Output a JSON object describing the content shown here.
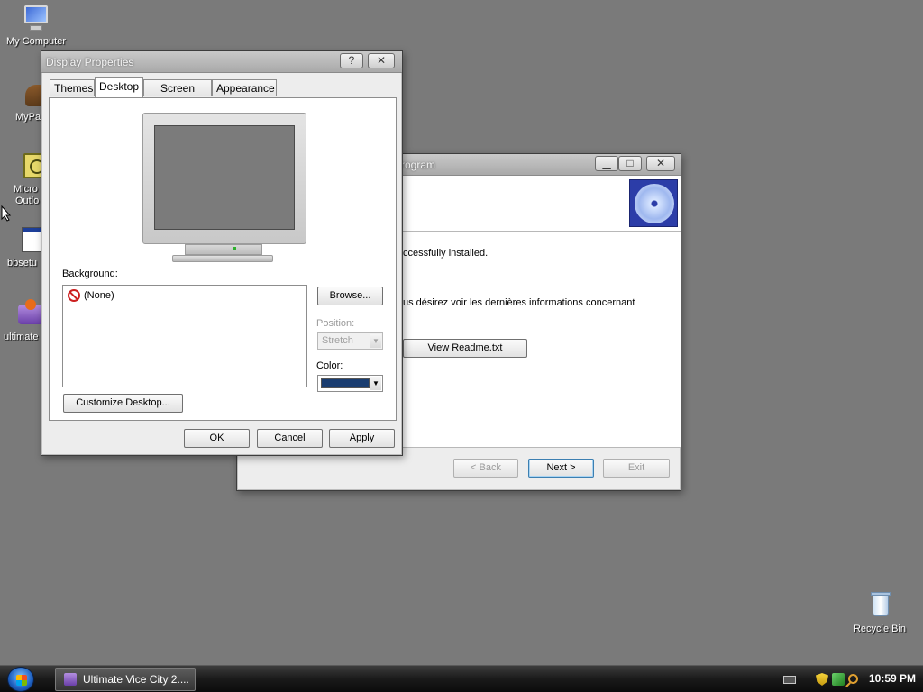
{
  "desktop": {
    "icons": [
      {
        "label": "My Computer",
        "icon": "computer-icon"
      },
      {
        "label": "MyPa",
        "icon": "folder-icon"
      },
      {
        "label": "Micro",
        "label2": "Outlo",
        "icon": "outlook-icon"
      },
      {
        "label": "bbsetu",
        "icon": "setup-icon"
      },
      {
        "label": "ultimate",
        "icon": "installer-icon"
      },
      {
        "label": "Recycle Bin",
        "icon": "recycle-bin-icon"
      }
    ]
  },
  "display_properties": {
    "title": "Display Properties",
    "help_glyph": "?",
    "close_glyph": "✕",
    "tabs": [
      {
        "label": "Themes"
      },
      {
        "label": "Desktop"
      },
      {
        "label": "Screen Saver"
      },
      {
        "label": "Appearance"
      }
    ],
    "background_label": "Background:",
    "background_items": [
      "(None)"
    ],
    "browse_label": "Browse...",
    "position_label": "Position:",
    "position_value": "Stretch",
    "color_label": "Color:",
    "color_value": "#1a3d70",
    "customize_label": "Customize Desktop...",
    "ok_label": "OK",
    "cancel_label": "Cancel",
    "apply_label": "Apply"
  },
  "installer": {
    "title_fragment": "rogram",
    "minimize_glyph": "▁",
    "maximize_glyph": "□",
    "close_glyph": "✕",
    "line_installed": "ccessfully installed.",
    "line_readme": "us désirez voir les dernières informations concernant",
    "readme_label": "View Readme.txt",
    "back_label": "< Back",
    "next_label": "Next >",
    "exit_label": "Exit"
  },
  "taskbar": {
    "task_label": "Ultimate Vice City 2....",
    "clock": "10:59 PM"
  }
}
